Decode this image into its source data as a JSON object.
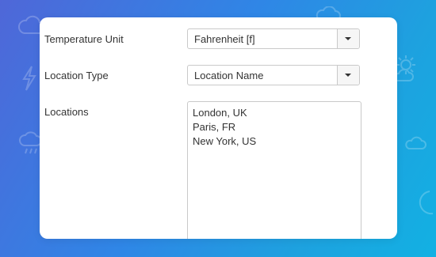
{
  "form": {
    "temperature_unit": {
      "label": "Temperature Unit",
      "value": "Fahrenheit [f]"
    },
    "location_type": {
      "label": "Location Type",
      "value": "Location Name"
    },
    "locations": {
      "label": "Locations",
      "lines": [
        "London, UK",
        "Paris, FR",
        "New York, US"
      ]
    }
  },
  "background_icons": [
    "cloud-icon",
    "cloud-rain-icon",
    "cloud-lightning-icon",
    "cloud-moon-icon",
    "sun-cloud-icon",
    "cloud-outline-icon",
    "moon-icon"
  ],
  "colors": {
    "background_start": "#4f67d8",
    "background_end": "#12b1e3",
    "panel": "#ffffff",
    "text": "#333333",
    "border": "#c9c9c9"
  }
}
